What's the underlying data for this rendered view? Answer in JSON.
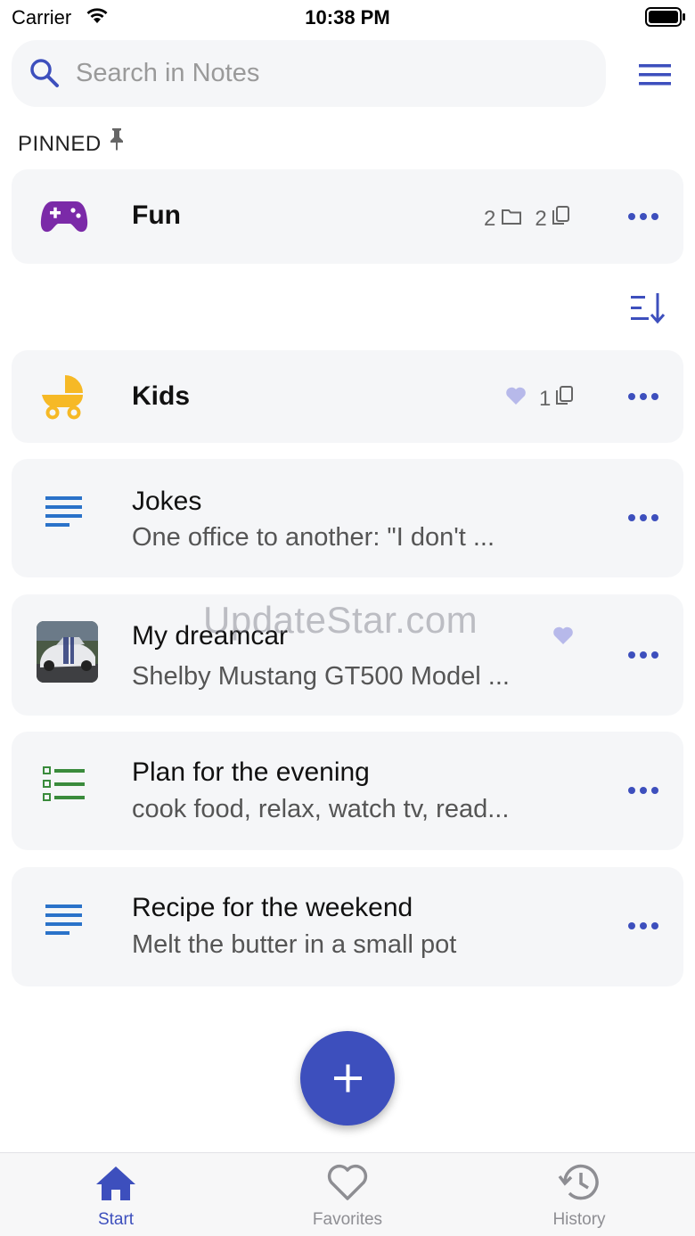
{
  "status_bar": {
    "carrier": "Carrier",
    "time": "10:38 PM"
  },
  "search": {
    "placeholder": "Search in Notes"
  },
  "pinned": {
    "header": "PINNED",
    "items": [
      {
        "title": "Fun",
        "folder_count": "2",
        "note_count": "2",
        "icon": "gamepad-icon"
      }
    ]
  },
  "notes": [
    {
      "title": "Kids",
      "note_count": "1",
      "favorite": true,
      "icon": "stroller-icon"
    },
    {
      "title": "Jokes",
      "subtitle": "One office to another: \"I don't ...",
      "icon": "text-note-icon"
    },
    {
      "title": "My dreamcar",
      "subtitle": "Shelby Mustang GT500 Model ...",
      "favorite": true,
      "icon": "car-thumbnail"
    },
    {
      "title": "Plan for the evening",
      "subtitle": "cook food, relax, watch tv, read...",
      "icon": "checklist-icon"
    },
    {
      "title": "Recipe for the weekend",
      "subtitle": "Melt the butter in a small pot",
      "icon": "text-note-icon"
    }
  ],
  "watermark": "UpdateStar.com",
  "tabs": [
    {
      "label": "Start",
      "icon": "home-icon",
      "active": true
    },
    {
      "label": "Favorites",
      "icon": "heart-icon",
      "active": false
    },
    {
      "label": "History",
      "icon": "history-icon",
      "active": false
    }
  ],
  "colors": {
    "accent": "#3d4fbd",
    "card_bg": "#f5f6f8",
    "gamepad": "#7b2aa8",
    "stroller": "#f6b926",
    "text_note": "#2a72c9",
    "checklist": "#3a8b3c",
    "favorite_heart": "#b7b9ea",
    "tab_inactive": "#8e8e93"
  }
}
